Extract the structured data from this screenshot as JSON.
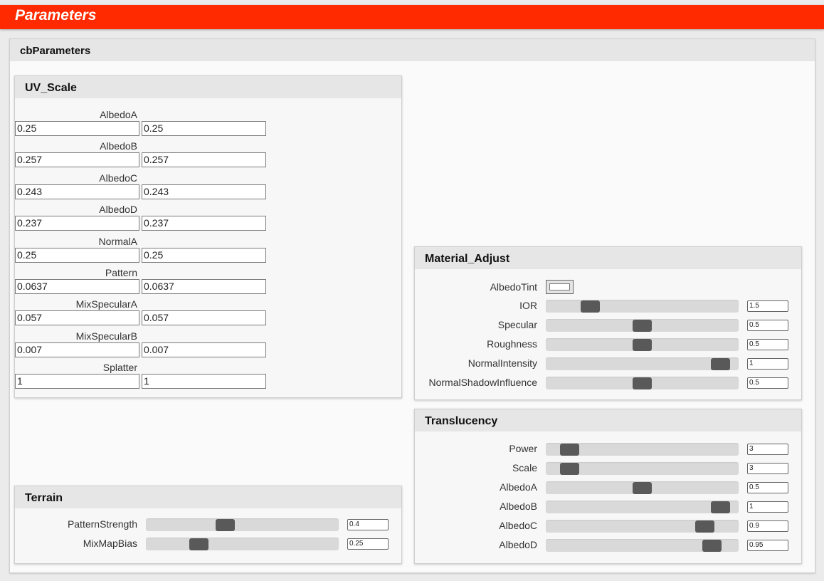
{
  "header": {
    "title": "Parameters"
  },
  "main": {
    "title": "cbParameters"
  },
  "uv_scale": {
    "title": "UV_Scale",
    "rows": [
      {
        "label": "AlbedoA",
        "v1": "0.25",
        "v2": "0.25"
      },
      {
        "label": "AlbedoB",
        "v1": "0.257",
        "v2": "0.257"
      },
      {
        "label": "AlbedoC",
        "v1": "0.243",
        "v2": "0.243"
      },
      {
        "label": "AlbedoD",
        "v1": "0.237",
        "v2": "0.237"
      },
      {
        "label": "NormalA",
        "v1": "0.25",
        "v2": "0.25"
      },
      {
        "label": "Pattern",
        "v1": "0.0637",
        "v2": "0.0637"
      },
      {
        "label": "MixSpecularA",
        "v1": "0.057",
        "v2": "0.057"
      },
      {
        "label": "MixSpecularB",
        "v1": "0.007",
        "v2": "0.007"
      },
      {
        "label": "Splatter",
        "v1": "1",
        "v2": "1"
      }
    ]
  },
  "terrain": {
    "title": "Terrain",
    "sliders": [
      {
        "label": "PatternStrength",
        "value": "0.4",
        "fraction": 0.4
      },
      {
        "label": "MixMapBias",
        "value": "0.25",
        "fraction": 0.25
      }
    ]
  },
  "material_adjust": {
    "title": "Material_Adjust",
    "tint_label": "AlbedoTint",
    "tint_color": "#ffffff",
    "sliders": [
      {
        "label": "IOR",
        "value": "1.5",
        "fraction": 0.2
      },
      {
        "label": "Specular",
        "value": "0.5",
        "fraction": 0.5
      },
      {
        "label": "Roughness",
        "value": "0.5",
        "fraction": 0.5
      },
      {
        "label": "NormalIntensity",
        "value": "1",
        "fraction": 0.95
      },
      {
        "label": "NormalShadowInfluence",
        "value": "0.5",
        "fraction": 0.5
      }
    ]
  },
  "translucency": {
    "title": "Translucency",
    "sliders": [
      {
        "label": "Power",
        "value": "3",
        "fraction": 0.08
      },
      {
        "label": "Scale",
        "value": "3",
        "fraction": 0.08
      },
      {
        "label": "AlbedoA",
        "value": "0.5",
        "fraction": 0.5
      },
      {
        "label": "AlbedoB",
        "value": "1",
        "fraction": 0.95
      },
      {
        "label": "AlbedoC",
        "value": "0.9",
        "fraction": 0.86
      },
      {
        "label": "AlbedoD",
        "value": "0.95",
        "fraction": 0.9
      }
    ]
  },
  "colors": {
    "header": "#ff2a00",
    "thumb": "#595959",
    "track": "#d9d9d9"
  }
}
